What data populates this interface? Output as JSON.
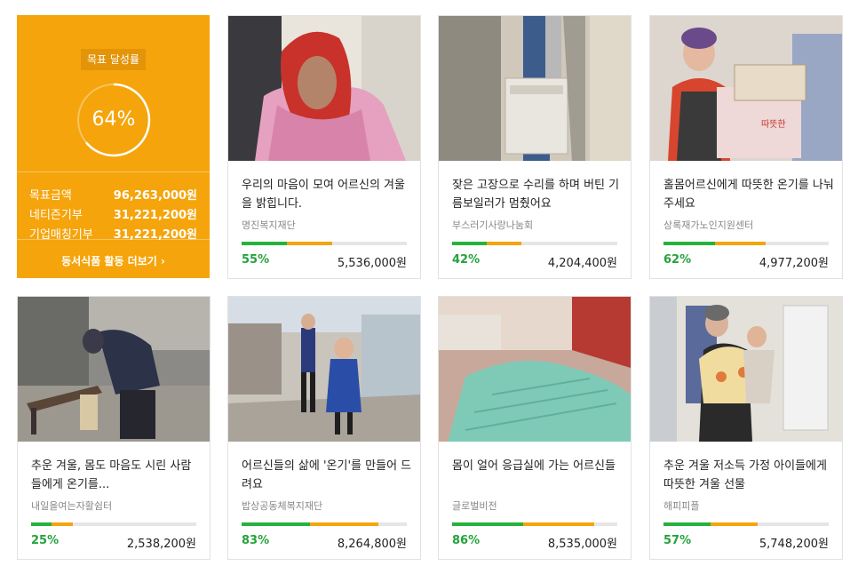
{
  "summary": {
    "badge": "목표 달성률",
    "percent_label": "64%",
    "percent": 64,
    "stats": [
      {
        "label": "목표금액",
        "value": "96,263,000원"
      },
      {
        "label": "네티즌기부",
        "value": "31,221,200원"
      },
      {
        "label": "기업매칭기부",
        "value": "31,221,200원"
      }
    ],
    "more_link": "동서식품 활동 더보기 ›"
  },
  "cards": [
    {
      "title": "우리의 마음이 모여 어르신의 겨울을 밝힙니다.",
      "org": "명진복지재단",
      "pct_label": "55%",
      "pct": 55,
      "amount": "5,536,000원",
      "photo": "elderly-woman-red-scarf-photo"
    },
    {
      "title": "잦은 고장으로 수리를 하며 버틴 기름보일러가 멈췄어요",
      "org": "부스러기사랑나눔회",
      "pct_label": "42%",
      "pct": 42,
      "amount": "4,204,400원",
      "photo": "oil-boiler-photo"
    },
    {
      "title": "홀몸어르신에게 따뜻한 온기를 나눠주세요",
      "org": "상록재가노인지원센터",
      "pct_label": "62%",
      "pct": 62,
      "amount": "4,977,200원",
      "photo": "elderly-woman-gift-box-photo"
    },
    {
      "title": "추운 겨울, 몸도 마음도 시린 사람들에게 온기를...",
      "org": "내일을여는자활쉼터",
      "pct_label": "25%",
      "pct": 25,
      "amount": "2,538,200원",
      "photo": "man-bending-at-bench-photo"
    },
    {
      "title": "어르신들의 삶에 '온기'를 만들어 드려요",
      "org": "밥상공동체복지재단",
      "pct_label": "83%",
      "pct": 83,
      "amount": "8,264,800원",
      "photo": "child-on-stairs-photo"
    },
    {
      "title": "몸이 얼어 응급실에 가는 어르신들",
      "org": "글로벌비전",
      "pct_label": "86%",
      "pct": 86,
      "amount": "8,535,000원",
      "photo": "mint-blanket-photo"
    },
    {
      "title": "추운 겨울 저소득 가정 아이들에게 따뜻한 겨울 선물",
      "org": "해피피플",
      "pct_label": "57%",
      "pct": 57,
      "amount": "5,748,200원",
      "photo": "mother-and-child-photo"
    }
  ],
  "colors": {
    "accent": "#f5a40b",
    "progress_green": "#25b33b",
    "track": "#e6e6e6"
  }
}
